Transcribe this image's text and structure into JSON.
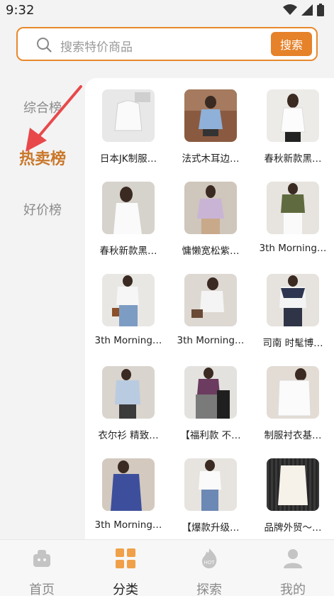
{
  "status_bar": {
    "time": "9:32"
  },
  "search": {
    "placeholder": "搜索特价商品",
    "button_label": "搜索"
  },
  "sidebar": {
    "items": [
      {
        "label": "综合榜",
        "active": false
      },
      {
        "label": "热卖榜",
        "active": true
      },
      {
        "label": "好价榜",
        "active": false
      }
    ]
  },
  "products": [
    {
      "title": "日本JK制服…"
    },
    {
      "title": "法式木耳边…"
    },
    {
      "title": "春秋新款黑…"
    },
    {
      "title": "春秋新款黑…"
    },
    {
      "title": "慵懒宽松紫…"
    },
    {
      "title": "3th Morning…"
    },
    {
      "title": "3th Morning…"
    },
    {
      "title": "3th Morning…"
    },
    {
      "title": "司南 时髦博…"
    },
    {
      "title": "衣尔衫 精致…"
    },
    {
      "title": "【福利款 不…"
    },
    {
      "title": "制服衬衣基…"
    },
    {
      "title": "3th Morning…"
    },
    {
      "title": "【爆款升级…"
    },
    {
      "title": "品牌外贸〜…"
    }
  ],
  "bottom_nav": {
    "items": [
      {
        "label": "首页",
        "icon": "home-icon",
        "active": false
      },
      {
        "label": "分类",
        "icon": "category-grid-icon",
        "active": true
      },
      {
        "label": "探索",
        "icon": "hot-flame-icon",
        "active": false
      },
      {
        "label": "我的",
        "icon": "profile-icon",
        "active": false
      }
    ]
  },
  "colors": {
    "accent": "#e5822a",
    "active_sidebar": "#c9772a",
    "annotation_arrow": "#e8484a"
  }
}
